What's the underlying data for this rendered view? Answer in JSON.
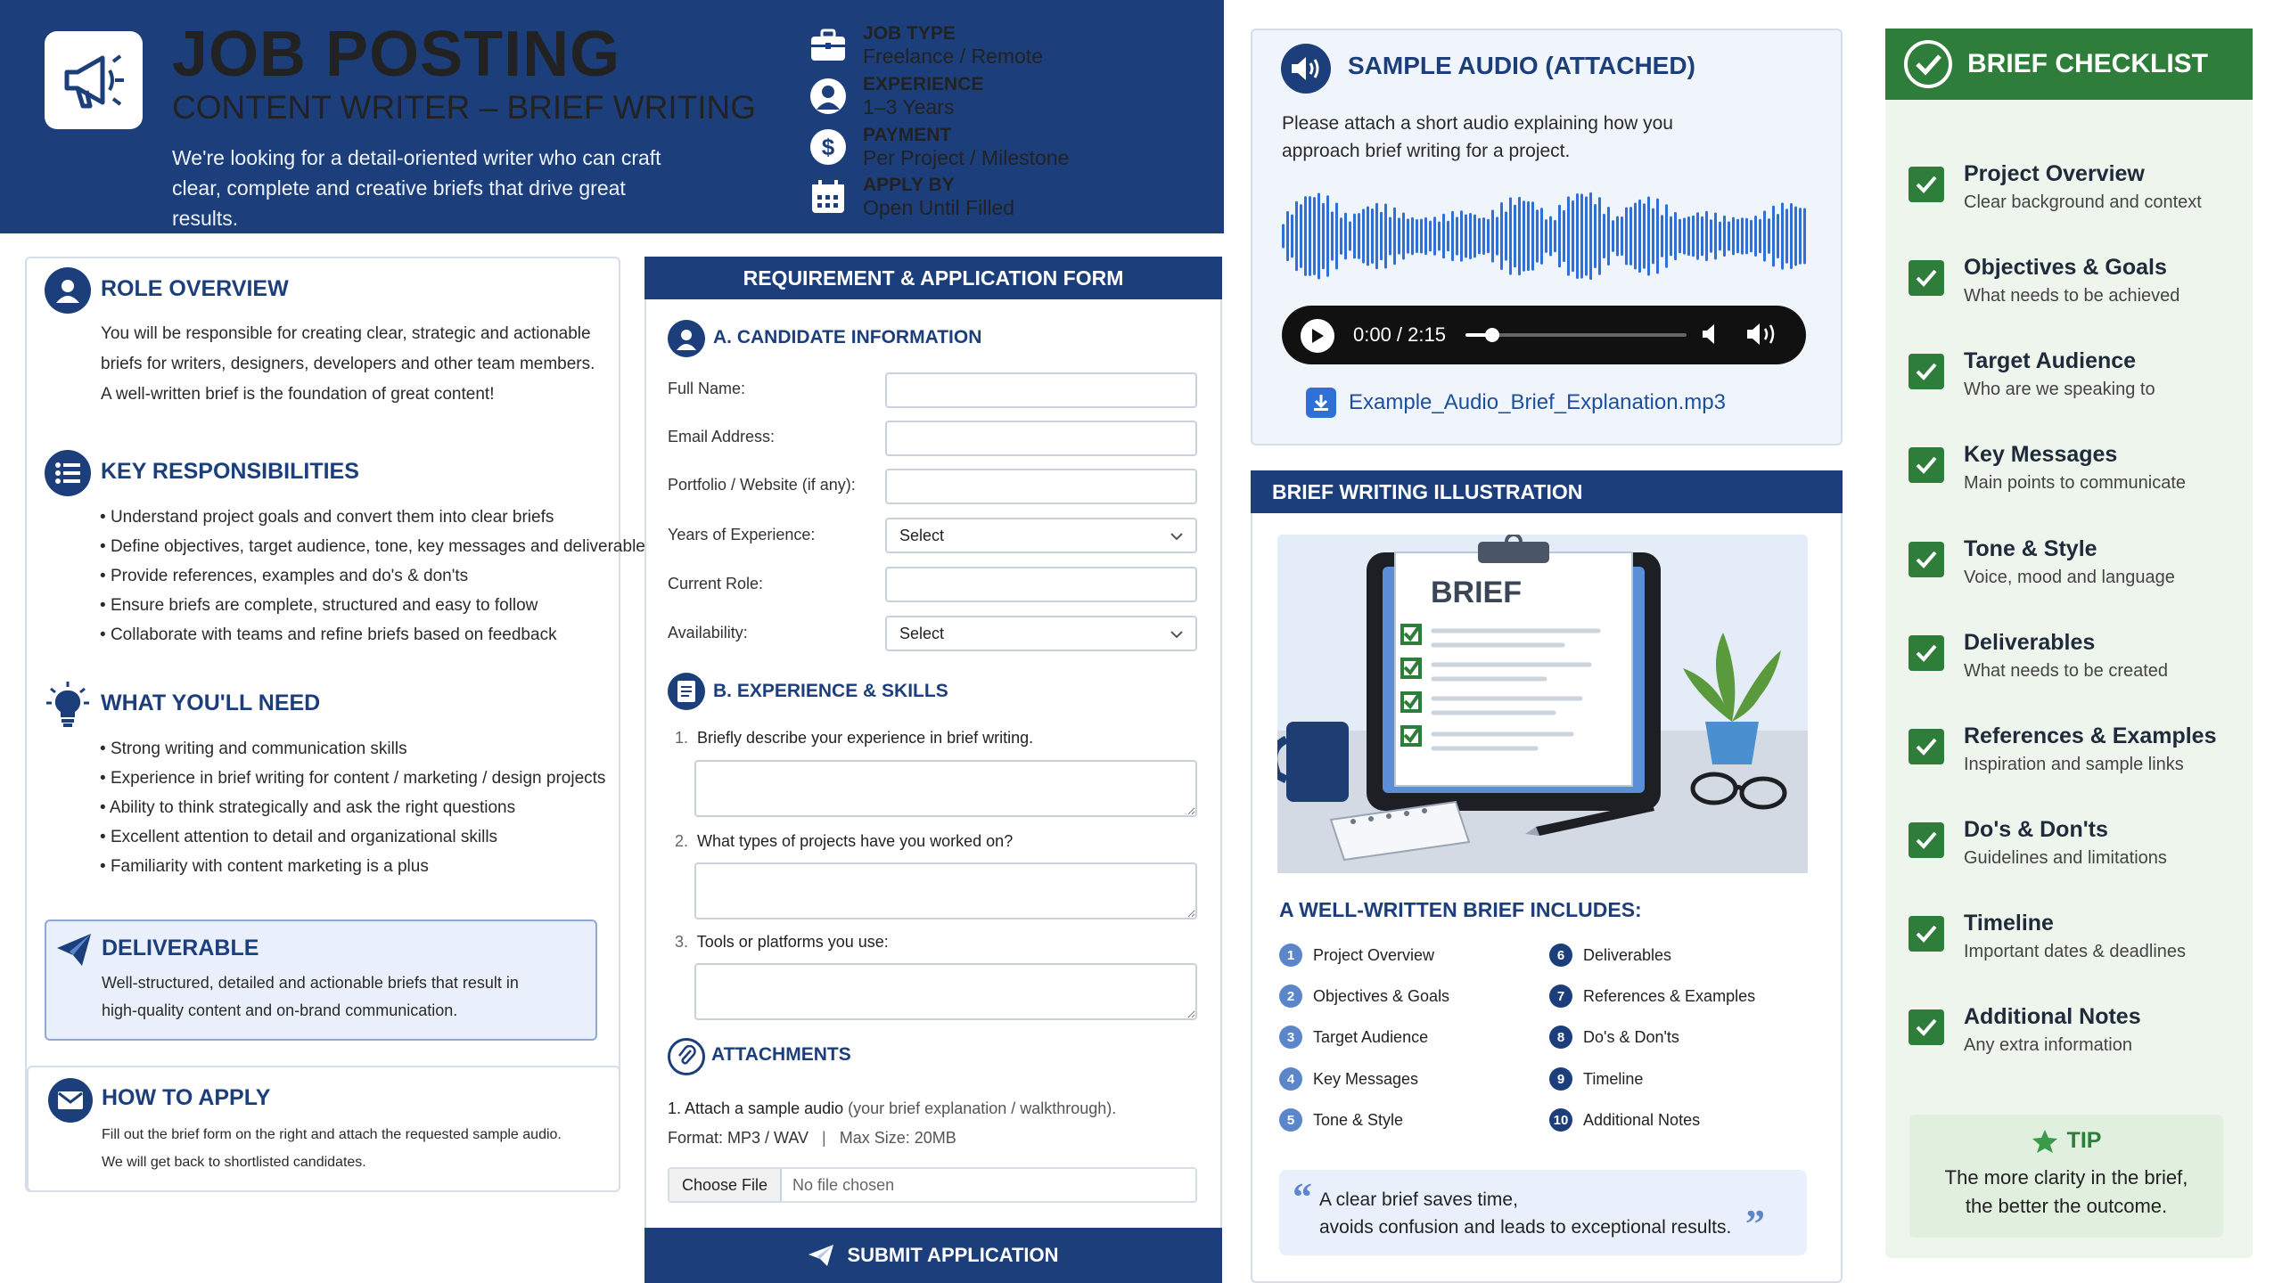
{
  "header": {
    "title": "JOB POSTING",
    "subtitle": "CONTENT WRITER – BRIEF WRITING",
    "description": "We're looking for a detail-oriented writer who can craft clear, complete and creative briefs that drive great results.",
    "meta": [
      {
        "label": "JOB TYPE",
        "value": "Freelance / Remote",
        "icon": "briefcase-icon"
      },
      {
        "label": "EXPERIENCE",
        "value": "1–3 Years",
        "icon": "user-icon"
      },
      {
        "label": "PAYMENT",
        "value": "Per Project / Milestone",
        "icon": "dollar-icon"
      },
      {
        "label": "APPLY BY",
        "value": "Open Until Filled",
        "icon": "calendar-icon"
      }
    ]
  },
  "role": {
    "title": "ROLE OVERVIEW",
    "line1": "You will be responsible for creating clear, strategic and actionable",
    "line2": "briefs for writers, designers, developers and other team members.",
    "line3": "A well-written brief is the foundation of great content!"
  },
  "responsibilities": {
    "title": "KEY RESPONSIBILITIES",
    "items": [
      "Understand project goals and convert them into clear briefs",
      "Define objectives, target audience, tone, key messages and deliverables",
      "Provide references, examples and do's & don'ts",
      "Ensure briefs are complete, structured and easy to follow",
      "Collaborate with teams and refine briefs based on feedback"
    ]
  },
  "needs": {
    "title": "WHAT YOU'LL NEED",
    "items": [
      "Strong writing and communication skills",
      "Experience in brief writing for content / marketing / design projects",
      "Ability to think strategically and ask the right questions",
      "Excellent attention to detail and organizational skills",
      "Familiarity with content marketing is a plus"
    ]
  },
  "deliverable": {
    "title": "DELIVERABLE",
    "line1": "Well-structured, detailed and actionable briefs that result in",
    "line2": "high-quality content and on-brand communication."
  },
  "apply": {
    "title": "HOW TO APPLY",
    "line1": "Fill out the brief form on the right and attach the requested sample audio.",
    "line2": "We will get back to shortlisted candidates."
  },
  "form": {
    "header": "REQUIREMENT & APPLICATION FORM",
    "section_a": "A. CANDIDATE INFORMATION",
    "fields": {
      "full_name": "Full Name:",
      "email": "Email Address:",
      "portfolio": "Portfolio / Website (if any):",
      "years": "Years of Experience:",
      "current_role": "Current Role:",
      "availability": "Availability:"
    },
    "select_value": "Select",
    "section_b": "B. EXPERIENCE & SKILLS",
    "q1": "Briefly describe your experience in brief writing.",
    "q2": "What types of projects have you worked on?",
    "q3": "Tools or platforms you use:",
    "attachments_title": "ATTACHMENTS",
    "attach_line1_bold": "1. Attach a sample audio",
    "attach_line1_rest": " (your brief explanation / walkthrough).",
    "attach_format": "Format: MP3 / WAV",
    "attach_size": "Max Size: 20MB",
    "choose_file": "Choose File",
    "no_file": "No file chosen",
    "submit": "SUBMIT APPLICATION"
  },
  "audio": {
    "title": "SAMPLE AUDIO (ATTACHED)",
    "line1": "Please attach a short audio explaining how you",
    "line2": "approach brief writing for a project.",
    "time": "0:00 / 2:15",
    "progress": 0.12,
    "file_name": "Example_Audio_Brief_Explanation.mp3"
  },
  "illustration": {
    "title": "BRIEF WRITING ILLUSTRATION",
    "board_text": "BRIEF",
    "includes_title": "A WELL-WRITTEN BRIEF INCLUDES:",
    "items_left": [
      {
        "n": "1",
        "t": "Project Overview"
      },
      {
        "n": "2",
        "t": "Objectives & Goals"
      },
      {
        "n": "3",
        "t": "Target Audience"
      },
      {
        "n": "4",
        "t": "Key Messages"
      },
      {
        "n": "5",
        "t": "Tone & Style"
      }
    ],
    "items_right": [
      {
        "n": "6",
        "t": "Deliverables"
      },
      {
        "n": "7",
        "t": "References & Examples"
      },
      {
        "n": "8",
        "t": "Do's & Don'ts"
      },
      {
        "n": "9",
        "t": "Timeline"
      },
      {
        "n": "10",
        "t": "Additional Notes"
      }
    ],
    "quote_line1": "A clear brief saves time,",
    "quote_line2": "avoids confusion and leads to exceptional results."
  },
  "checklist": {
    "title": "BRIEF CHECKLIST",
    "items": [
      {
        "title": "Project Overview",
        "sub": "Clear background and context"
      },
      {
        "title": "Objectives & Goals",
        "sub": "What needs to be achieved"
      },
      {
        "title": "Target Audience",
        "sub": "Who are we speaking to"
      },
      {
        "title": "Key Messages",
        "sub": "Main points to communicate"
      },
      {
        "title": "Tone & Style",
        "sub": "Voice, mood and language"
      },
      {
        "title": "Deliverables",
        "sub": "What needs to be created"
      },
      {
        "title": "References & Examples",
        "sub": "Inspiration and sample links"
      },
      {
        "title": "Do's & Don'ts",
        "sub": "Guidelines and limitations"
      },
      {
        "title": "Timeline",
        "sub": "Important dates & deadlines"
      },
      {
        "title": "Additional Notes",
        "sub": "Any extra information"
      }
    ],
    "tip_label": "TIP",
    "tip_line1": "The more clarity in the brief,",
    "tip_line2": "the better the outcome."
  },
  "colors": {
    "navy": "#1c3f7c",
    "green": "#2e7d3a",
    "light_blue": "#e9f0fb"
  }
}
